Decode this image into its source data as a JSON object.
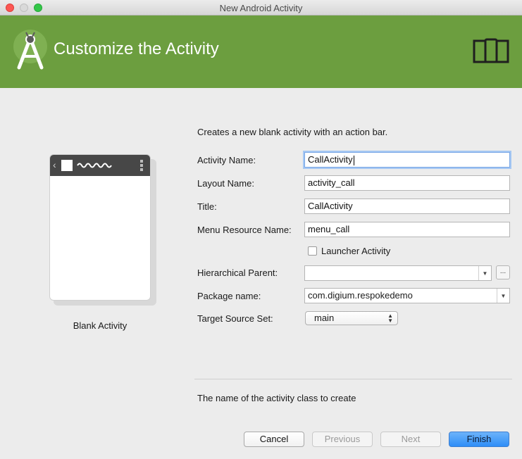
{
  "window": {
    "title": "New Android Activity"
  },
  "header": {
    "heading": "Customize the Activity",
    "background": "#6c9e3f"
  },
  "preview": {
    "label": "Blank Activity"
  },
  "form": {
    "description": "Creates a new blank activity with an action bar.",
    "activity_name": {
      "label": "Activity Name:",
      "value": "CallActivity"
    },
    "layout_name": {
      "label": "Layout Name:",
      "value": "activity_call"
    },
    "title": {
      "label": "Title:",
      "value": "CallActivity"
    },
    "menu_resource_name": {
      "label": "Menu Resource Name:",
      "value": "menu_call"
    },
    "launcher_activity": {
      "label": "Launcher Activity",
      "checked": false
    },
    "hierarchical_parent": {
      "label": "Hierarchical Parent:",
      "value": "",
      "browse_label": "..."
    },
    "package_name": {
      "label": "Package name:",
      "value": "com.digium.respokedemo"
    },
    "target_source_set": {
      "label": "Target Source Set:",
      "value": "main"
    }
  },
  "hint": "The name of the activity class to create",
  "buttons": {
    "cancel": "Cancel",
    "previous": "Previous",
    "next": "Next",
    "finish": "Finish"
  },
  "colors": {
    "accent": "#6c9e3f",
    "primary_button": "#2e8ef7"
  }
}
